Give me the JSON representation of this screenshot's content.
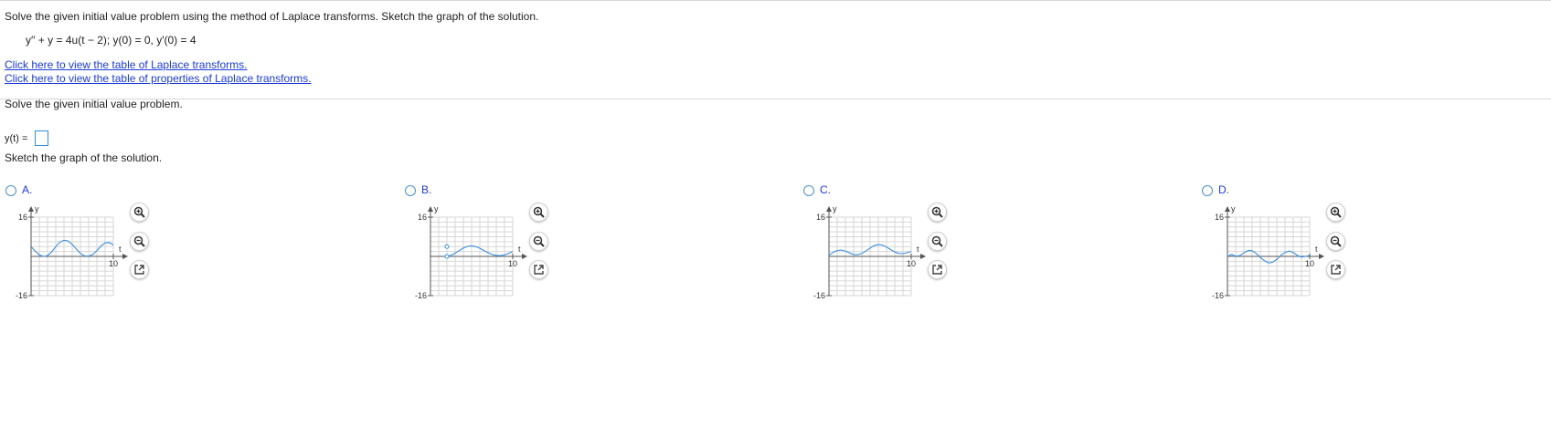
{
  "question": {
    "instruction": "Solve the given initial value problem using the method of Laplace transforms. Sketch the graph of the solution.",
    "equation": "y′′ + y = 4u(t − 2);   y(0) = 0,   y′(0) = 4",
    "link_table": "Click here to view the table of Laplace transforms.",
    "link_properties": "Click here to view the table of properties of Laplace transforms."
  },
  "part1": {
    "prompt": "Solve the given initial value problem.",
    "answer_label": "y(t) ="
  },
  "part2": {
    "prompt": "Sketch the graph of the solution."
  },
  "options": [
    {
      "label": "A.",
      "icon": "radio-button"
    },
    {
      "label": "B.",
      "icon": "radio-button"
    },
    {
      "label": "C.",
      "icon": "radio-button"
    },
    {
      "label": "D.",
      "icon": "radio-button"
    }
  ],
  "tools": {
    "zoom_in": "zoom-in-icon",
    "zoom_out": "zoom-out-icon",
    "popout": "popout-icon"
  },
  "chart_data": [
    {
      "type": "line",
      "xlim": [
        0,
        10
      ],
      "ylim": [
        -16,
        16
      ],
      "grid": true,
      "tick_labels": {
        "y_top": "16",
        "y_bottom": "-16",
        "x_right": "10",
        "x_axis": "t",
        "y_axis": "y"
      },
      "series": [
        {
          "x": [
            0,
            0.5,
            1,
            1.5,
            2,
            2.5,
            3,
            3.5,
            4,
            4.5,
            5,
            5.5,
            6,
            6.5,
            7,
            7.5,
            8,
            8.5,
            9,
            9.5,
            10
          ],
          "y": [
            4,
            2.2,
            0.6,
            0,
            0.3,
            1.8,
            4,
            5.8,
            6.6,
            6.3,
            4.9,
            3,
            1.2,
            0.2,
            0.1,
            0.8,
            2.4,
            4.2,
            5.5,
            5.6,
            4.7
          ]
        }
      ],
      "color": "#3a8fe0"
    },
    {
      "type": "line",
      "xlim": [
        0,
        10
      ],
      "ylim": [
        -16,
        16
      ],
      "grid": true,
      "tick_labels": {
        "y_top": "16",
        "y_bottom": "-16",
        "x_right": "10",
        "x_axis": "t",
        "y_axis": "y"
      },
      "series": [
        {
          "x": [
            2,
            2.5,
            3,
            3.5,
            4,
            4.5,
            5,
            5.5,
            6,
            6.5,
            7,
            7.5,
            8,
            8.5,
            9,
            9.5,
            10
          ],
          "y": [
            0,
            0.4,
            1.3,
            2.4,
            3.4,
            4.1,
            4.3,
            4.0,
            3.3,
            2.4,
            1.5,
            0.8,
            0.4,
            0.3,
            0.6,
            1.2,
            2.0
          ]
        }
      ],
      "markers": [
        {
          "x": 2,
          "y": 4,
          "filled": false
        },
        {
          "x": 2,
          "y": 0,
          "filled": false
        }
      ],
      "color": "#3a8fe0"
    },
    {
      "type": "line",
      "xlim": [
        0,
        10
      ],
      "ylim": [
        -16,
        16
      ],
      "grid": true,
      "tick_labels": {
        "y_top": "16",
        "y_bottom": "-16",
        "x_right": "10",
        "x_axis": "t",
        "y_axis": "y"
      },
      "series": [
        {
          "x": [
            0,
            0.5,
            1,
            1.5,
            2,
            2.5,
            3,
            3.5,
            4,
            4.5,
            5,
            5.5,
            6,
            6.5,
            7,
            7.5,
            8,
            8.5,
            9,
            9.5,
            10
          ],
          "y": [
            0.5,
            1.6,
            2.4,
            2.6,
            2.2,
            1.4,
            0.8,
            0.7,
            1.2,
            2.2,
            3.4,
            4.4,
            4.8,
            4.6,
            3.8,
            2.8,
            1.8,
            1.2,
            1.1,
            1.5,
            2.0
          ]
        }
      ],
      "color": "#3a8fe0"
    },
    {
      "type": "line",
      "xlim": [
        0,
        10
      ],
      "ylim": [
        -16,
        16
      ],
      "grid": true,
      "tick_labels": {
        "y_top": "16",
        "y_bottom": "-16",
        "x_right": "10",
        "x_axis": "t",
        "y_axis": "y"
      },
      "series": [
        {
          "x": [
            0,
            0.5,
            1,
            1.5,
            2,
            2.5,
            3,
            3.5,
            4,
            4.5,
            5,
            5.5,
            6,
            6.5,
            7,
            7.5,
            8,
            8.5,
            9,
            9.5,
            10
          ],
          "y": [
            0,
            0.8,
            0.1,
            0.3,
            1.4,
            2.4,
            2.3,
            1.2,
            -0.4,
            -1.8,
            -2.6,
            -2.4,
            -1.2,
            0.4,
            1.6,
            2.2,
            1.6,
            0.4,
            -0.3,
            0,
            0.4
          ]
        }
      ],
      "color": "#3a8fe0"
    }
  ]
}
